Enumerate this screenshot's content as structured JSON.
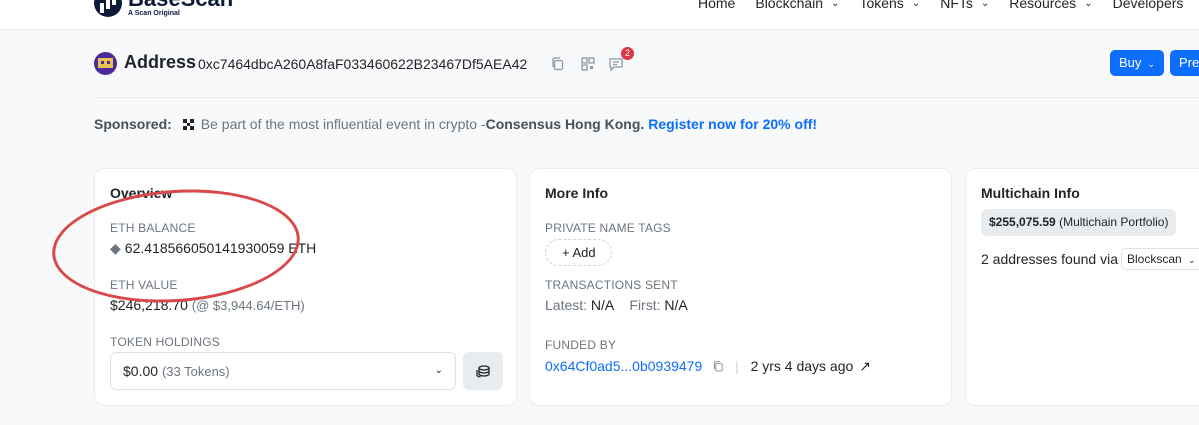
{
  "brand": {
    "name": "BaseScan",
    "tagline": "A Scan Original"
  },
  "nav": [
    "Home",
    "Blockchain",
    "Tokens",
    "NFTs",
    "Resources",
    "Developers"
  ],
  "header": {
    "title": "Address",
    "address": "0xc7464dbcA260A8faF033460622B23467Df5AEA42",
    "comment_count": "2",
    "buy_label": "Buy",
    "pres_label": "Pres"
  },
  "sponsor": {
    "label": "Sponsored:",
    "text": "Be part of the most influential event in crypto - ",
    "strong": "Consensus Hong Kong.",
    "link": "Register now for 20% off!"
  },
  "overview": {
    "title": "Overview",
    "eth_balance_label": "ETH BALANCE",
    "eth_balance": "62.418566050141930059 ETH",
    "eth_value_label": "ETH VALUE",
    "eth_value": "$246,218.70",
    "eth_price": "(@ $3,944.64/ETH)",
    "token_holdings_label": "TOKEN HOLDINGS",
    "token_value": "$0.00",
    "token_count": "(33 Tokens)"
  },
  "more_info": {
    "title": "More Info",
    "private_tags_label": "PRIVATE NAME TAGS",
    "add_label": "+ Add",
    "tx_sent_label": "TRANSACTIONS SENT",
    "latest_label": "Latest:",
    "latest_value": "N/A",
    "first_label": "First:",
    "first_value": "N/A",
    "funded_by_label": "FUNDED BY",
    "funded_by_address": "0x64Cf0ad5...0b0939479",
    "funded_age": "2 yrs 4 days ago"
  },
  "multichain": {
    "title": "Multichain Info",
    "portfolio_value": "$255,075.59",
    "portfolio_label": "(Multichain Portfolio)",
    "addresses_text": "2 addresses found via",
    "select_value": "Blockscan"
  },
  "colors": {
    "accent": "#0d6efd",
    "annotation": "#d9484a",
    "badge": "#dc3545"
  }
}
